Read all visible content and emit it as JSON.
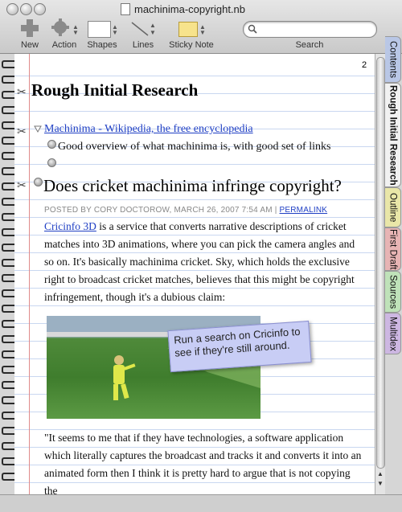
{
  "window": {
    "title": "machinima-copyright.nb"
  },
  "toolbar": {
    "new_label": "New",
    "action_label": "Action",
    "shapes_label": "Shapes",
    "lines_label": "Lines",
    "sticky_label": "Sticky Note",
    "search_label": "Search",
    "search_placeholder": "",
    "sticky_color": "#f7e38c"
  },
  "page": {
    "number": "2",
    "heading": "Rough Initial Research",
    "link_item": "Machinima - Wikipedia, the free encyclopedia",
    "link_note": "Good overview of what machinima is, with good set of links",
    "article_title": "Does cricket machinima infringe copyright?",
    "byline": "POSTED BY CORY DOCTOROW, MARCH 26, 2007 7:54 AM |",
    "permalink": "PERMALINK",
    "para1_link": "Cricinfo 3D",
    "para1_text": " is a service that converts narrative descriptions of cricket matches into 3D animations, where you can pick the camera angles and so on. It's basically machinima cricket. Sky, which holds the exclusive right to broadcast cricket matches, believes that this might be copyright infringement, though it's a dubious claim:",
    "sticky_note": "Run a search on Cricinfo to see if they're still around.",
    "para2_text": "\"It seems to me that if they have technologies, a software application which literally captures the broadcast and tracks it and converts it into an animated form then I think it is pretty hard to argue that is not copying the"
  },
  "tabs": [
    {
      "label": "Contents",
      "color": "#b9c7e6"
    },
    {
      "label": "Rough Initial Research",
      "color": "#f1f1f1"
    },
    {
      "label": "Outline",
      "color": "#e9e6a8"
    },
    {
      "label": "First Draft",
      "color": "#e7b4b4"
    },
    {
      "label": "Sources",
      "color": "#bfe2b9"
    },
    {
      "label": "Multidex",
      "color": "#cdb7e2"
    }
  ]
}
